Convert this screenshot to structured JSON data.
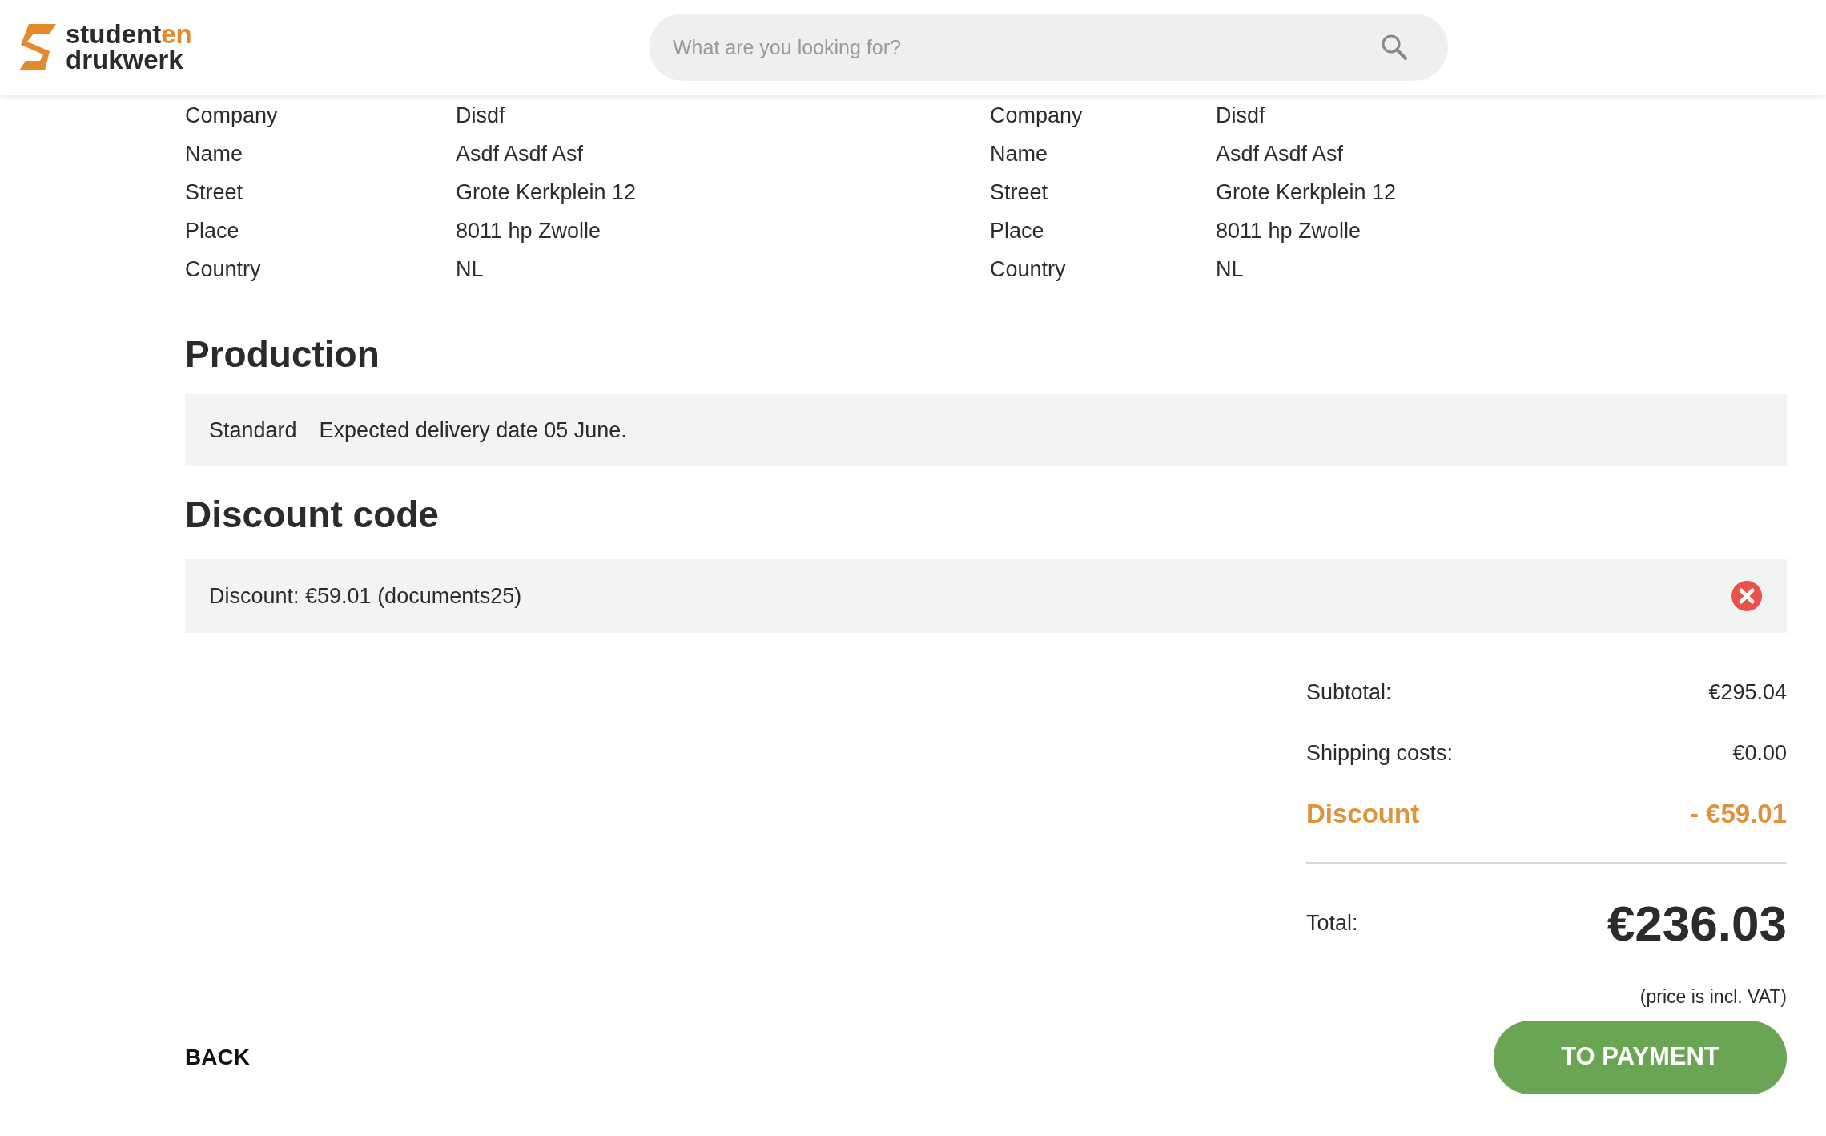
{
  "header": {
    "logo": {
      "line_1": "student",
      "line_1_accent": "en",
      "line_2": "drukwerk"
    },
    "search": {
      "placeholder": "What are you looking for?"
    }
  },
  "addresses": [
    {
      "rows": [
        {
          "label": "Company",
          "value": "Disdf"
        },
        {
          "label": "Name",
          "value": "Asdf Asdf Asf"
        },
        {
          "label": "Street",
          "value": "Grote Kerkplein 12"
        },
        {
          "label": "Place",
          "value": "8011 hp Zwolle"
        },
        {
          "label": "Country",
          "value": "NL"
        }
      ]
    },
    {
      "rows": [
        {
          "label": "Company",
          "value": "Disdf"
        },
        {
          "label": "Name",
          "value": "Asdf Asdf Asf"
        },
        {
          "label": "Street",
          "value": "Grote Kerkplein 12"
        },
        {
          "label": "Place",
          "value": "8011 hp Zwolle"
        },
        {
          "label": "Country",
          "value": "NL"
        }
      ]
    }
  ],
  "production": {
    "title": "Production",
    "option": "Standard",
    "delivery": "Expected delivery date 05 June."
  },
  "discount_code": {
    "title": "Discount code",
    "applied": "Discount: €59.01 (documents25)"
  },
  "summary": {
    "rows": [
      {
        "kind": "plain",
        "label": "Subtotal:",
        "value": "€295.04"
      },
      {
        "kind": "plain",
        "label": "Shipping costs:",
        "value": "€0.00"
      },
      {
        "kind": "discount",
        "label": "Discount",
        "value": "- €59.01"
      }
    ],
    "total_label": "Total:",
    "total_value": "€236.03",
    "vat_note": "(price is incl. VAT)"
  },
  "buttons": {
    "back": "BACK",
    "next": "TO PAYMENT"
  }
}
